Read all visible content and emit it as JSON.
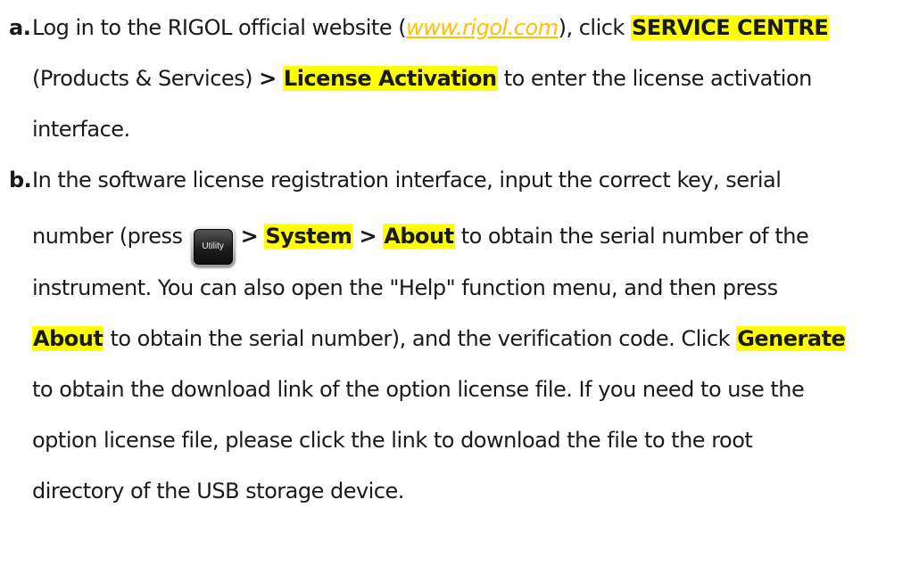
{
  "steps": [
    {
      "letter": "a.",
      "lines": {
        "l1_pre": "Log in to the RIGOL official website (",
        "l1_link": "www.rigol.com",
        "l1_mid": "), click ",
        "l1_hl": "SERVICE CENTRE",
        "l2_pre": "(Products & Services) ",
        "l2_gt": ">",
        "l2_hl": "License Activation",
        "l2_post": " to enter the license activation",
        "l3": "interface."
      }
    },
    {
      "letter": "b.",
      "lines": {
        "l1": "In the software license registration interface, input the correct key, serial",
        "l2_pre": "number (press ",
        "key_label": "Utility",
        "gt1": ">",
        "hl_system": "System",
        "gt2": ">",
        "hl_about": "About",
        "l2_post": " to obtain the serial number of the",
        "l3": "instrument. You can also open the \"Help\" function menu, and then press",
        "l4_hl": "About",
        "l4_mid": " to obtain the serial number), and the verification code. Click ",
        "l4_hl2": "Generate",
        "l5": "to obtain the download link of the option license file. If you need to use the",
        "l6": "option license file, please click the link to download the file to the root",
        "l7": "directory of the USB storage device."
      }
    }
  ],
  "colors": {
    "highlight": "#ffff00",
    "link": "#ffc000",
    "text": "#1a1a1a"
  },
  "icons": {
    "utility_key": "utility-key-icon"
  }
}
